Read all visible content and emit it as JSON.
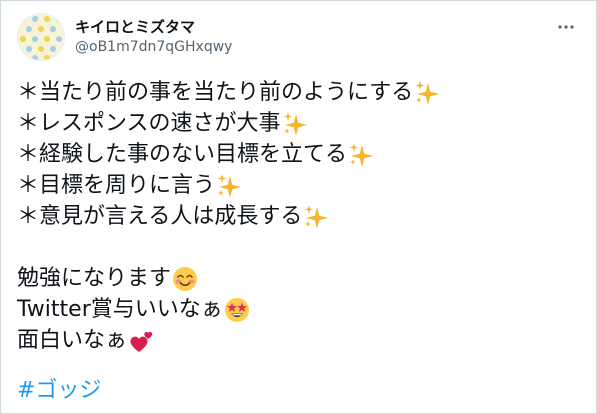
{
  "tweet": {
    "display_name": "キイロとミズタマ",
    "handle": "@oB1m7dn7qGHxqwy",
    "more_icon": "more-dots-icon",
    "lines": [
      {
        "text": "＊当たり前の事を当たり前のようにする",
        "emoji": "sparkles"
      },
      {
        "text": "＊レスポンスの速さが大事",
        "emoji": "sparkles"
      },
      {
        "text": "＊経験した事のない目標を立てる",
        "emoji": "sparkles"
      },
      {
        "text": "＊目標を周りに言う",
        "emoji": "sparkles"
      },
      {
        "text": "＊意見が言える人は成長する",
        "emoji": "sparkles"
      },
      {
        "text": "勉強になります",
        "emoji": "smiling-face-blush"
      },
      {
        "text": "Twitter賞与いいなぁ",
        "emoji": "star-struck"
      },
      {
        "text": "面白いなぁ",
        "emoji": "two-hearts"
      }
    ],
    "hashtag": "#ゴッジ"
  },
  "colors": {
    "text": "#0f1419",
    "secondary": "#536471",
    "link": "#1d9bf0",
    "border": "#cfd9de",
    "sparkle": "#f6b52b",
    "heart": "#d81e4f"
  }
}
